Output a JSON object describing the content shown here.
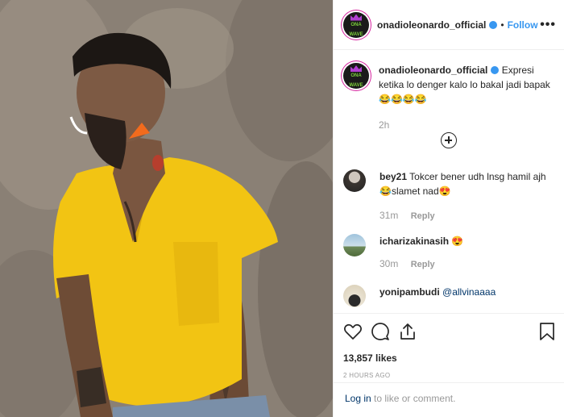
{
  "post": {
    "username": "onadioleonardo_official",
    "follow_label": "Follow",
    "separator": "•",
    "more_label": "•••",
    "avatar_logo_text": "ONA WAVE"
  },
  "caption": {
    "username": "onadioleonardo_official",
    "text": "Expresi ketika lo denger kalo lo bakal jadi bapak 😂😂😂😂",
    "time": "2h"
  },
  "comments": [
    {
      "username": "bey21",
      "text": "Tokcer bener udh lnsg hamil ajh😂slamet nad😍",
      "time": "31m",
      "reply_label": "Reply"
    },
    {
      "username": "icharizakinasih",
      "text": "😍",
      "time": "30m",
      "reply_label": "Reply"
    },
    {
      "username": "yonipambudi",
      "text": "@allvinaaaa",
      "time": "",
      "reply_label": ""
    }
  ],
  "stats": {
    "likes": "13,857 likes",
    "posted_ago": "2 HOURS AGO"
  },
  "footer": {
    "login_link": "Log in",
    "login_rest": " to like or comment."
  },
  "icons": {
    "verified": "verified-badge-icon",
    "load_more": "plus-circle-icon",
    "like": "heart-icon",
    "comment": "comment-bubble-icon",
    "share": "share-icon",
    "save": "bookmark-icon"
  },
  "colors": {
    "link_blue": "#3897f0",
    "mention_blue": "#003569",
    "muted": "#999999",
    "shirt_yellow": "#f2c413"
  }
}
